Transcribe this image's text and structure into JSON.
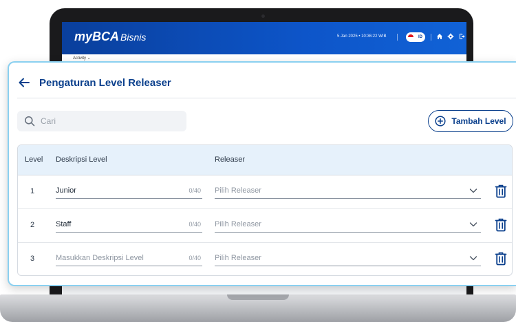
{
  "background_app": {
    "logo_my": "my",
    "logo_bca": "BCA",
    "logo_bisnis": "Bisnis",
    "datetime": "5 Jan 2025 • 10:36:22 WIB",
    "language": "ID",
    "menu_activity": "Activity ⌄"
  },
  "dialog": {
    "title": "Pengaturan Level Releaser",
    "search": {
      "placeholder": "Cari",
      "value": ""
    },
    "add_button_label": "Tambah Level",
    "table": {
      "headers": {
        "level": "Level",
        "description": "Deskripsi Level",
        "releaser": "Releaser"
      },
      "rows": [
        {
          "level": "1",
          "description": "Junior",
          "description_placeholder": "",
          "char_count": "0/40",
          "releaser_placeholder": "Pilih Releaser"
        },
        {
          "level": "2",
          "description": "Staff",
          "description_placeholder": "",
          "char_count": "0/40",
          "releaser_placeholder": "Pilih Releaser"
        },
        {
          "level": "3",
          "description": "",
          "description_placeholder": "Masukkan Deskripsi Level",
          "char_count": "0/40",
          "releaser_placeholder": "Pilih Releaser"
        }
      ]
    }
  },
  "colors": {
    "primary": "#0a3f8c",
    "header_bg": "#e6f1fb",
    "card_border": "#8ad0f0",
    "app_bar": "#0d55c9"
  },
  "icons": [
    "back-arrow-icon",
    "search-icon",
    "plus-circle-icon",
    "chevron-down-icon",
    "trash-icon",
    "home-icon",
    "gear-icon",
    "logout-icon"
  ]
}
